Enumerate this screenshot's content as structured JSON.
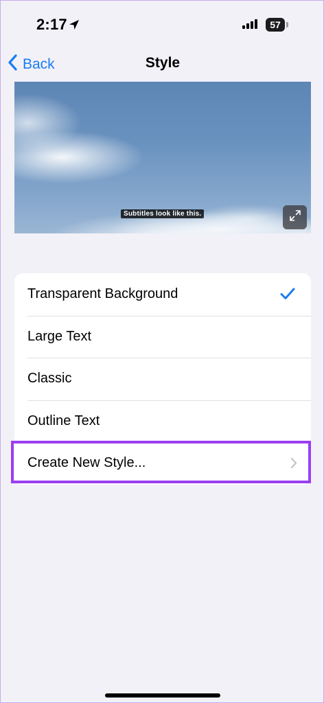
{
  "status_bar": {
    "time": "2:17",
    "battery": "57"
  },
  "nav": {
    "back_label": "Back",
    "title": "Style"
  },
  "preview": {
    "subtitle": "Subtitles look like this."
  },
  "styles": [
    {
      "label": "Transparent Background",
      "selected": true
    },
    {
      "label": "Large Text",
      "selected": false
    },
    {
      "label": "Classic",
      "selected": false
    },
    {
      "label": "Outline Text",
      "selected": false
    },
    {
      "label": "Create New Style...",
      "selected": false
    }
  ],
  "colors": {
    "accent": "#1a7cf2",
    "highlight": "#9a3ff2",
    "background": "#f2f1f7"
  }
}
